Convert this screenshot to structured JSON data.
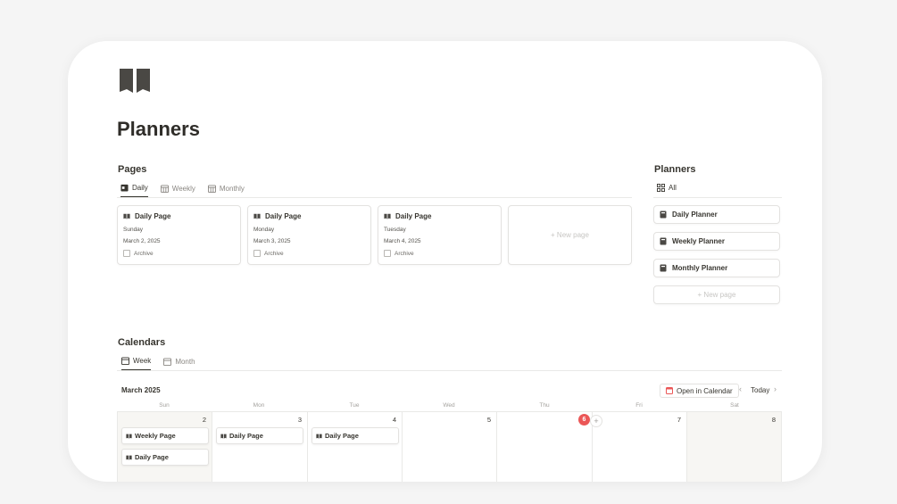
{
  "page": {
    "title": "Planners",
    "icon": "open-book-icon"
  },
  "pages_section": {
    "heading": "Pages",
    "tabs": [
      {
        "label": "Daily",
        "icon": "calendar-day-icon",
        "active": true
      },
      {
        "label": "Weekly",
        "icon": "calendar-grid-icon",
        "active": false
      },
      {
        "label": "Monthly",
        "icon": "calendar-grid-icon",
        "active": false
      }
    ],
    "cards": [
      {
        "title": "Daily Page",
        "day": "Sunday",
        "date": "March 2, 2025",
        "archive_label": "Archive"
      },
      {
        "title": "Daily Page",
        "day": "Monday",
        "date": "March 3, 2025",
        "archive_label": "Archive"
      },
      {
        "title": "Daily Page",
        "day": "Tuesday",
        "date": "March 4, 2025",
        "archive_label": "Archive"
      }
    ],
    "new_page_label": "+ New page"
  },
  "planners_section": {
    "heading": "Planners",
    "tab_all": "All",
    "items": [
      "Daily Planner",
      "Weekly Planner",
      "Monthly Planner"
    ],
    "new_page_label": "+ New page"
  },
  "calendars_section": {
    "heading": "Calendars",
    "tabs": [
      {
        "label": "Week",
        "active": true
      },
      {
        "label": "Month",
        "active": false
      }
    ],
    "month_label": "March 2025",
    "open_in_calendar": "Open in Calendar",
    "today_label": "Today",
    "prev_arrow": "‹",
    "next_arrow": "›",
    "days_of_week": [
      "Sun",
      "Mon",
      "Tue",
      "Wed",
      "Thu",
      "Fri",
      "Sat"
    ],
    "day_numbers": [
      "2",
      "3",
      "4",
      "5",
      "6",
      "7",
      "8"
    ],
    "today_index": 4,
    "plus_label": "+",
    "events": {
      "sun": [
        "Weekly Page",
        "Daily Page"
      ],
      "mon": [
        "Daily Page"
      ],
      "tue": [
        "Daily Page"
      ]
    }
  },
  "colors": {
    "accent_today": "#eb5757",
    "text": "#37352f",
    "muted": "#a3a19d",
    "weekend_bg": "#f7f6f3"
  }
}
